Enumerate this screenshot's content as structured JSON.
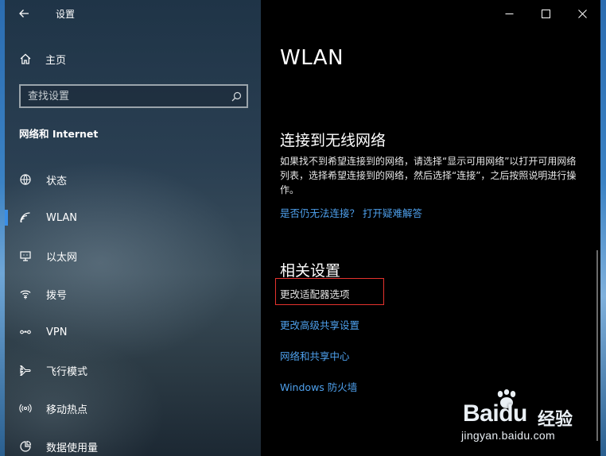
{
  "window": {
    "title": "设置"
  },
  "nav": {
    "home_label": "主页",
    "search_placeholder": "查找设置",
    "section_title": "网络和 Internet",
    "items": [
      {
        "label": "状态",
        "icon": "globe-icon"
      },
      {
        "label": "WLAN",
        "icon": "wifi-icon",
        "active": true
      },
      {
        "label": "以太网",
        "icon": "ethernet-icon"
      },
      {
        "label": "拨号",
        "icon": "dialup-icon"
      },
      {
        "label": "VPN",
        "icon": "vpn-icon"
      },
      {
        "label": "飞行模式",
        "icon": "airplane-icon"
      },
      {
        "label": "移动热点",
        "icon": "hotspot-icon"
      },
      {
        "label": "数据使用量",
        "icon": "data-usage-icon"
      }
    ]
  },
  "content": {
    "page_title": "WLAN",
    "connect_heading": "连接到无线网络",
    "connect_desc": "如果找不到希望连接到的网络，请选择“显示可用网络”以打开可用网络列表，选择希望连接到的网络，然后选择“连接”，之后按照说明进行操作。",
    "trouble_link": "是否仍无法连接？ 打开疑难解答",
    "related_heading": "相关设置",
    "adapter_link": "更改适配器选项",
    "sharing_link": "更改高级共享设置",
    "center_link": "网络和共享中心",
    "firewall_link": "Windows 防火墙"
  },
  "watermark": {
    "brand_a": "Bai",
    "brand_b": "du",
    "brand_cn": "经验",
    "url": "jingyan.baidu.com"
  },
  "colors": {
    "accent": "#3a8ee6",
    "link": "#4ea0ec",
    "highlight": "#e5322d"
  }
}
